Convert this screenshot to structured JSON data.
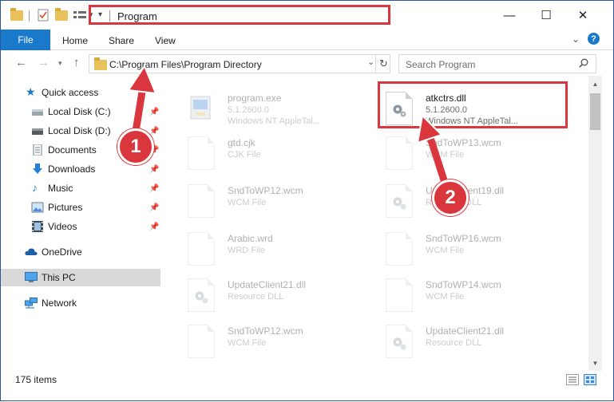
{
  "window": {
    "title": "Program",
    "controls": {
      "minimize": "—",
      "maximize": "☐",
      "close": "✕"
    }
  },
  "ribbon": {
    "tabs": [
      {
        "label": "File",
        "active": true
      },
      {
        "label": "Home"
      },
      {
        "label": "Share"
      },
      {
        "label": "View"
      }
    ]
  },
  "navigation": {
    "address": "C:\\Program Files\\Program Directory",
    "search_placeholder": "Search Program"
  },
  "sidebar": {
    "items": [
      {
        "label": "Quick access",
        "icon": "star-icon"
      },
      {
        "label": "Local Disk (C:)",
        "icon": "drive-icon",
        "pinned": true
      },
      {
        "label": "Local Disk (D:)",
        "icon": "drive-icon",
        "pinned": true
      },
      {
        "label": "Documents",
        "icon": "documents-icon",
        "pinned": true
      },
      {
        "label": "Downloads",
        "icon": "download-icon",
        "pinned": true
      },
      {
        "label": "Music",
        "icon": "music-icon",
        "pinned": true
      },
      {
        "label": "Pictures",
        "icon": "pictures-icon",
        "pinned": true
      },
      {
        "label": "Videos",
        "icon": "videos-icon",
        "pinned": true
      },
      {
        "label": "OneDrive",
        "icon": "cloud-icon"
      },
      {
        "label": "This PC",
        "icon": "computer-icon",
        "selected": true
      },
      {
        "label": "Network",
        "icon": "network-icon"
      }
    ]
  },
  "files": [
    {
      "name": "program.exe",
      "line2": "5.1.2600.0",
      "line3": "Windows NT AppleTal...",
      "icon": "exe-icon"
    },
    {
      "name": "atkctrs.dll",
      "line2": "5.1.2600.0",
      "line3": "Windows NT AppleTal...",
      "icon": "dll-icon"
    },
    {
      "name": "gtd.cjk",
      "line2": "CJK File",
      "line3": "",
      "icon": "file-icon"
    },
    {
      "name": "SndToWP13.wcm",
      "line2": "WCM File",
      "line3": "",
      "icon": "file-icon"
    },
    {
      "name": "SndToWP12.wcm",
      "line2": "WCM File",
      "line3": "",
      "icon": "file-icon"
    },
    {
      "name": "UpdateClient19.dll",
      "line2": "Resource DLL",
      "line3": "",
      "icon": "dll-icon"
    },
    {
      "name": "Arabic.wrd",
      "line2": "WRD File",
      "line3": "",
      "icon": "file-icon"
    },
    {
      "name": "SndToWP16.wcm",
      "line2": "WCM File",
      "line3": "",
      "icon": "file-icon"
    },
    {
      "name": "UpdateClient21.dll",
      "line2": "Resource DLL",
      "line3": "",
      "icon": "dll-icon"
    },
    {
      "name": "SndToWP14.wcm",
      "line2": "WCM File",
      "line3": "",
      "icon": "file-icon"
    },
    {
      "name": "SndToWP12.wcm",
      "line2": "WCM File",
      "line3": "",
      "icon": "file-icon"
    },
    {
      "name": "UpdateClient21.dll",
      "line2": "Resource DLL",
      "line3": "",
      "icon": "dll-icon"
    }
  ],
  "status": {
    "item_count": "175 items"
  },
  "annotations": {
    "step1": "1",
    "step2": "2",
    "color": "#d9363e"
  },
  "colors": {
    "accent": "#1979ca"
  }
}
